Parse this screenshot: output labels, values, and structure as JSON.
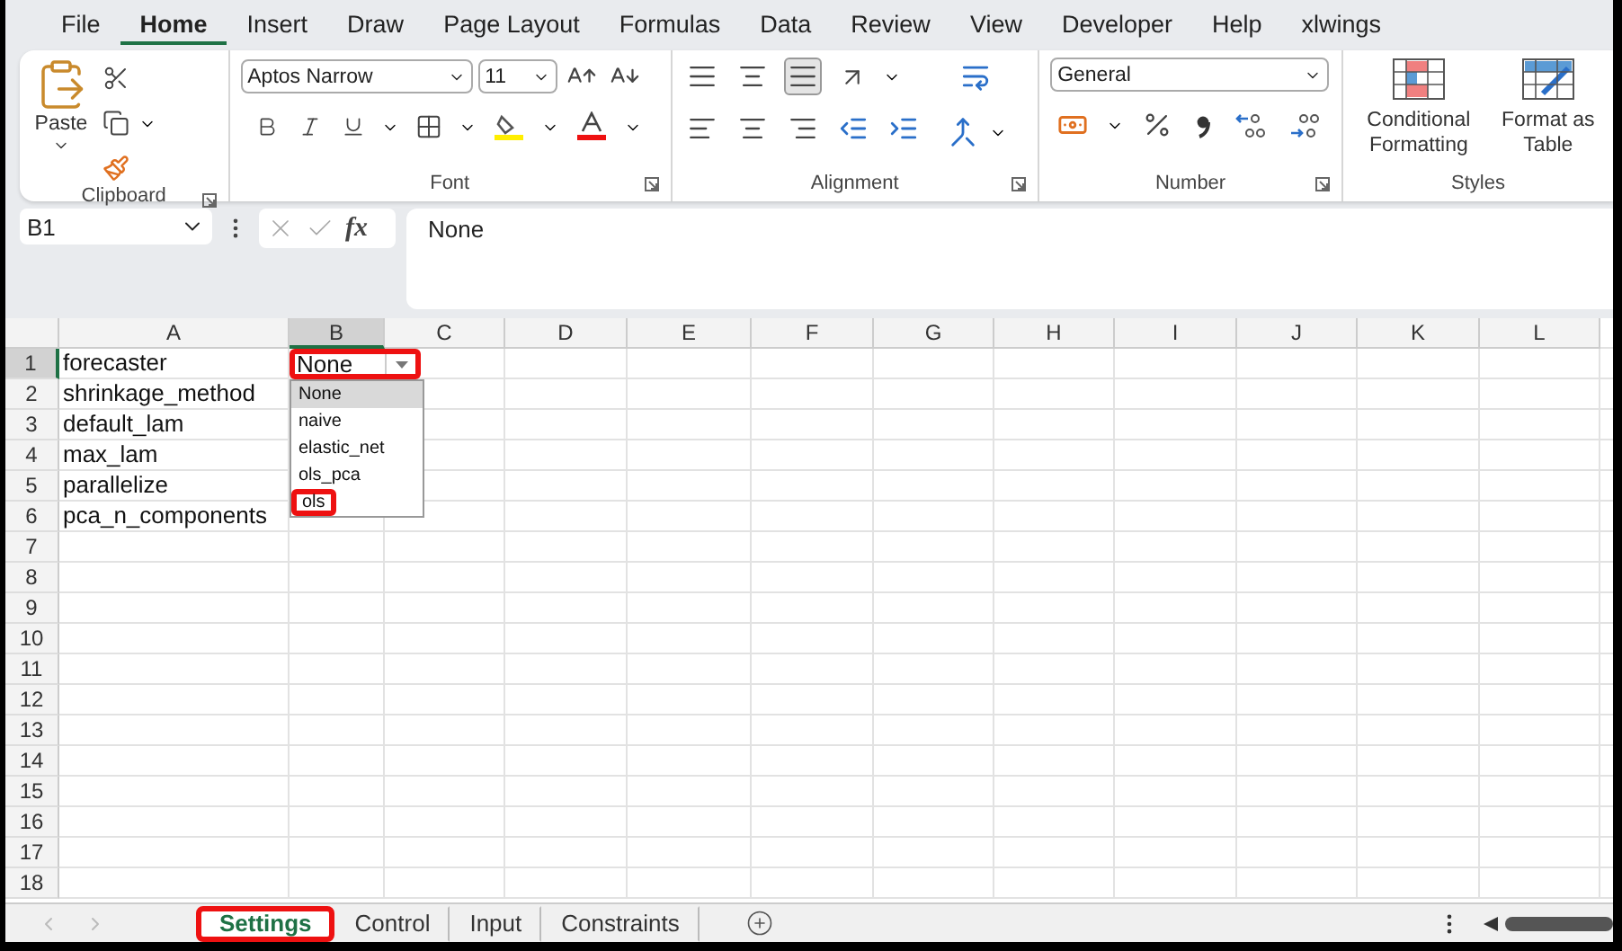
{
  "menu_tabs": [
    {
      "label": "File",
      "selected": false
    },
    {
      "label": "Home",
      "selected": true
    },
    {
      "label": "Insert",
      "selected": false
    },
    {
      "label": "Draw",
      "selected": false
    },
    {
      "label": "Page Layout",
      "selected": false
    },
    {
      "label": "Formulas",
      "selected": false
    },
    {
      "label": "Data",
      "selected": false
    },
    {
      "label": "Review",
      "selected": false
    },
    {
      "label": "View",
      "selected": false
    },
    {
      "label": "Developer",
      "selected": false
    },
    {
      "label": "Help",
      "selected": false
    },
    {
      "label": "xlwings",
      "selected": false
    }
  ],
  "ribbon": {
    "clipboard": {
      "label": "Clipboard",
      "paste": "Paste"
    },
    "font": {
      "label": "Font",
      "font_name": "Aptos Narrow",
      "font_size": "11"
    },
    "alignment": {
      "label": "Alignment"
    },
    "number": {
      "label": "Number",
      "format": "General"
    },
    "styles": {
      "label": "Styles",
      "buttons": [
        "Conditional Formatting",
        "Format as Table"
      ]
    }
  },
  "formula_bar": {
    "name_box": "B1",
    "function_label": "fx",
    "value": "None"
  },
  "sheet": {
    "columns": [
      {
        "label": "A",
        "selected": false
      },
      {
        "label": "B",
        "selected": true
      },
      {
        "label": "C",
        "selected": false
      },
      {
        "label": "D",
        "selected": false
      },
      {
        "label": "E",
        "selected": false
      },
      {
        "label": "F",
        "selected": false
      },
      {
        "label": "G",
        "selected": false
      },
      {
        "label": "H",
        "selected": false
      },
      {
        "label": "I",
        "selected": false
      },
      {
        "label": "J",
        "selected": false
      },
      {
        "label": "K",
        "selected": false
      },
      {
        "label": "L",
        "selected": false
      }
    ],
    "rows": [
      {
        "number": "1",
        "selected": true,
        "cells": [
          "forecaster"
        ]
      },
      {
        "number": "2",
        "selected": false,
        "cells": [
          "shrinkage_method"
        ]
      },
      {
        "number": "3",
        "selected": false,
        "cells": [
          "default_lam"
        ]
      },
      {
        "number": "4",
        "selected": false,
        "cells": [
          "max_lam"
        ]
      },
      {
        "number": "5",
        "selected": false,
        "cells": [
          "parallelize"
        ]
      },
      {
        "number": "6",
        "selected": false,
        "cells": [
          "pca_n_components"
        ]
      },
      {
        "number": "7",
        "selected": false,
        "cells": []
      },
      {
        "number": "8",
        "selected": false,
        "cells": []
      },
      {
        "number": "9",
        "selected": false,
        "cells": []
      },
      {
        "number": "10",
        "selected": false,
        "cells": []
      },
      {
        "number": "11",
        "selected": false,
        "cells": []
      },
      {
        "number": "12",
        "selected": false,
        "cells": []
      },
      {
        "number": "13",
        "selected": false,
        "cells": []
      },
      {
        "number": "14",
        "selected": false,
        "cells": []
      },
      {
        "number": "15",
        "selected": false,
        "cells": []
      },
      {
        "number": "16",
        "selected": false,
        "cells": []
      },
      {
        "number": "17",
        "selected": false,
        "cells": []
      },
      {
        "number": "18",
        "selected": false,
        "cells": []
      }
    ],
    "active_cell": {
      "value": "None",
      "highlighted": true
    },
    "dropdown": [
      {
        "label": "None",
        "selected": true,
        "highlighted": false
      },
      {
        "label": "naive",
        "selected": false,
        "highlighted": false
      },
      {
        "label": "elastic_net",
        "selected": false,
        "highlighted": false
      },
      {
        "label": "ols_pca",
        "selected": false,
        "highlighted": false
      },
      {
        "label": "ols",
        "selected": false,
        "highlighted": true
      }
    ]
  },
  "sheet_tabs": [
    {
      "label": "Settings",
      "selected": true,
      "highlighted": true
    },
    {
      "label": "Control",
      "selected": false,
      "highlighted": false
    },
    {
      "label": "Input",
      "selected": false,
      "highlighted": false
    },
    {
      "label": "Constraints",
      "selected": false,
      "highlighted": false
    }
  ]
}
